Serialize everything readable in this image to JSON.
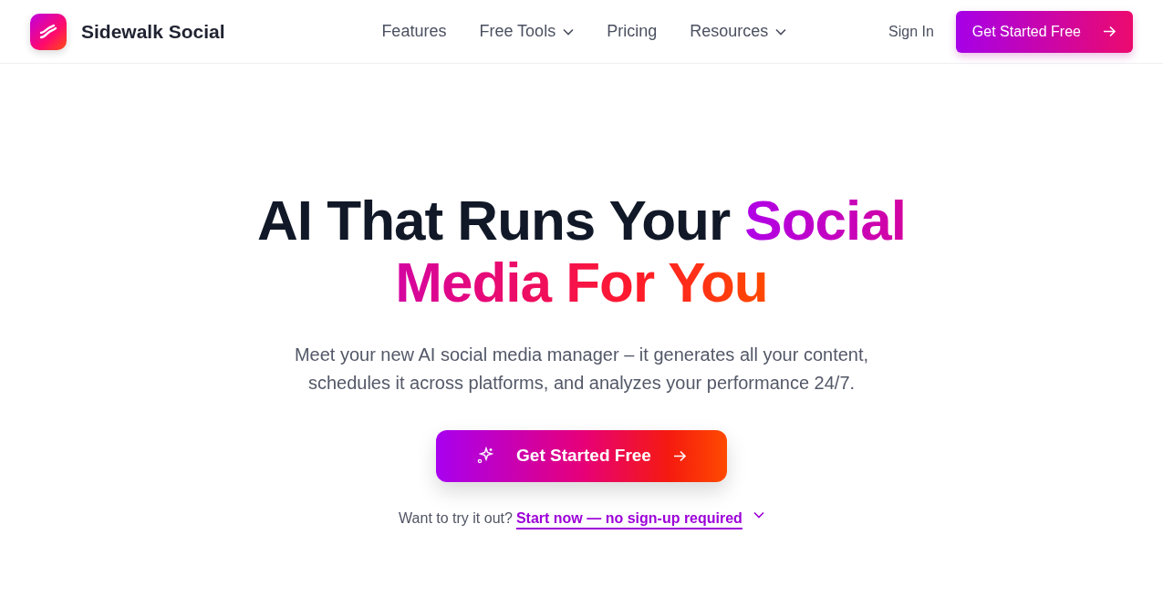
{
  "brand": {
    "name": "Sidewalk Social"
  },
  "nav": [
    {
      "label": "Features",
      "has_menu": false
    },
    {
      "label": "Free Tools",
      "has_menu": true
    },
    {
      "label": "Pricing",
      "has_menu": false
    },
    {
      "label": "Resources",
      "has_menu": true
    }
  ],
  "sign_in": "Sign In",
  "header_cta": "Get Started Free",
  "hero": {
    "headline": "AI That Runs Your",
    "headline_highlight": "Social Media For You",
    "subtitle": "Meet your new AI social media manager – it generates all your content, schedules it across platforms, and analyzes your performance 24/7.",
    "cta": "Get Started Free",
    "try_text": "Want to try it out?",
    "try_link": "Start now — no sign-up required"
  }
}
